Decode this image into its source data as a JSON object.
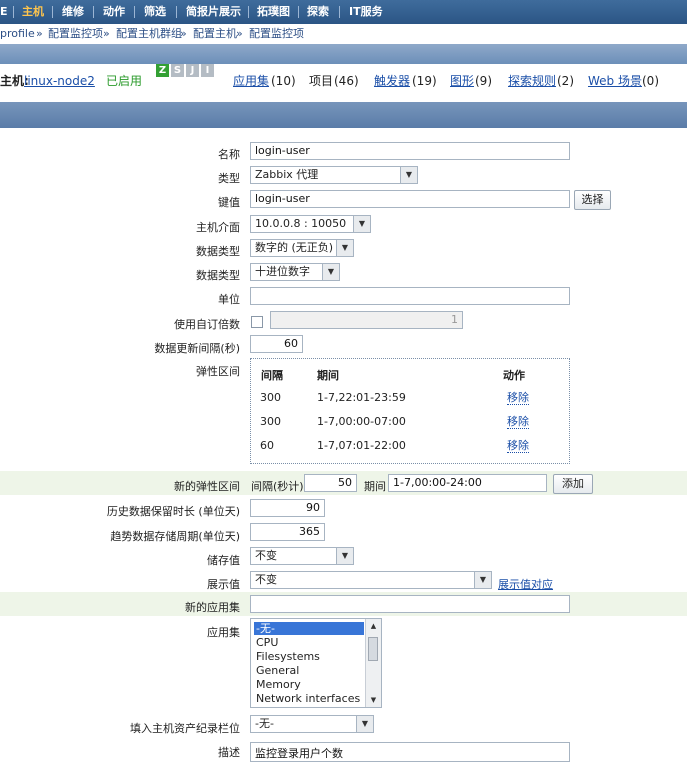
{
  "topnav": {
    "items": [
      "主机",
      "维修",
      "动作",
      "筛选",
      "简报片展示",
      "拓璞图",
      "探索",
      "IT服务"
    ],
    "partial": "E",
    "active": "主机"
  },
  "breadcrumb": {
    "items": [
      "profile",
      "配置监控项",
      "配置主机群组",
      "配置主机",
      "配置监控项"
    ],
    "separator": "»"
  },
  "hostline": {
    "host_label": "主机:",
    "host_name": "linux-node2",
    "status": "已启用",
    "badges": [
      "Z",
      "S",
      "J",
      "I"
    ],
    "links": [
      {
        "label": "应用集",
        "count": "(10)"
      },
      {
        "label": "项目",
        "count": "(46)"
      },
      {
        "label": "触发器",
        "count": "(19)"
      },
      {
        "label": "图形",
        "count": "(9)"
      },
      {
        "label": "探索规则",
        "count": "(2)"
      },
      {
        "label": "Web 场景",
        "count": "(0)"
      }
    ]
  },
  "form": {
    "name": {
      "label": "名称",
      "value": "login-user"
    },
    "type": {
      "label": "类型",
      "value": "Zabbix 代理"
    },
    "key": {
      "label": "键值",
      "value": "login-user",
      "button": "选择"
    },
    "interface": {
      "label": "主机介面",
      "value": "10.0.0.8 : 10050"
    },
    "data_type1": {
      "label": "数据类型",
      "value": "数字的 (无正负)"
    },
    "data_type2": {
      "label": "数据类型",
      "value": "十进位数字"
    },
    "units": {
      "label": "单位",
      "value": ""
    },
    "multiplier": {
      "label": "使用自订倍数",
      "value": "1"
    },
    "interval": {
      "label": "数据更新间隔(秒)",
      "value": "60"
    },
    "flexible": {
      "label": "弹性区间",
      "headers": [
        "间隔",
        "期间",
        "动作"
      ],
      "rows": [
        {
          "interval": "300",
          "period": "1-7,22:01-23:59",
          "action": "移除"
        },
        {
          "interval": "300",
          "period": "1-7,00:00-07:00",
          "action": "移除"
        },
        {
          "interval": "60",
          "period": "1-7,07:01-22:00",
          "action": "移除"
        }
      ]
    },
    "new_flexible": {
      "label": "新的弹性区间",
      "interval_label": "间隔(秒计)",
      "interval_value": "50",
      "period_label": "期间",
      "period_value": "1-7,00:00-24:00",
      "button": "添加"
    },
    "history": {
      "label": "历史数据保留时长 (单位天)",
      "value": "90"
    },
    "trends": {
      "label": "趋势数据存储周期(单位天)",
      "value": "365"
    },
    "store_value": {
      "label": "储存值",
      "value": "不变"
    },
    "show_value": {
      "label": "展示值",
      "value": "不变",
      "link": "展示值对应"
    },
    "new_app": {
      "label": "新的应用集",
      "value": ""
    },
    "applications": {
      "label": "应用集",
      "options": [
        "-无-",
        "CPU",
        "Filesystems",
        "General",
        "Memory",
        "Network interfaces"
      ],
      "selected": "-无-"
    },
    "inventory": {
      "label": "填入主机资产纪录栏位",
      "value": "-无-"
    },
    "description": {
      "label": "描述",
      "value": "监控登录用户个数"
    }
  }
}
